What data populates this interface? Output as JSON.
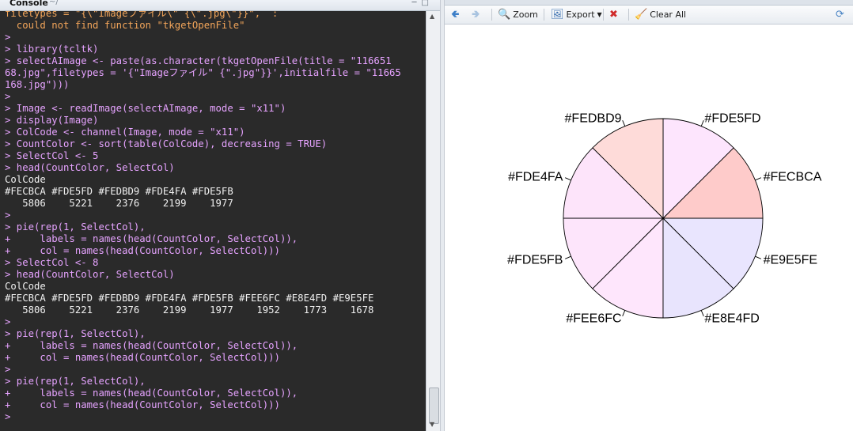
{
  "console": {
    "title": "Console",
    "path": "~/",
    "lines": [
      {
        "t": "filetypes = \"{\\\"Imageファイル\\\" {\\\".jpg\\\"}}\",  :",
        "k": "err"
      },
      {
        "t": "  could not find function \"tkgetOpenFile\"",
        "k": "err"
      },
      {
        "t": ">",
        "k": "cmd"
      },
      {
        "t": "> library(tcltk)",
        "k": "cmd"
      },
      {
        "t": "> selectAImage <- paste(as.character(tkgetOpenFile(title = \"116651",
        "k": "cmd"
      },
      {
        "t": "68.jpg\",filetypes = '{\"Imageファイル\" {\".jpg\"}}',initialfile = \"11665",
        "k": "cmd"
      },
      {
        "t": "168.jpg\")))",
        "k": "cmd"
      },
      {
        "t": ">",
        "k": "cmd"
      },
      {
        "t": "> Image <- readImage(selectAImage, mode = \"x11\")",
        "k": "cmd"
      },
      {
        "t": "> display(Image)",
        "k": "cmd"
      },
      {
        "t": "> ColCode <- channel(Image, mode = \"x11\")",
        "k": "cmd"
      },
      {
        "t": "> CountColor <- sort(table(ColCode), decreasing = TRUE)",
        "k": "cmd"
      },
      {
        "t": "> SelectCol <- 5",
        "k": "cmd"
      },
      {
        "t": "> head(CountColor, SelectCol)",
        "k": "cmd"
      },
      {
        "t": "ColCode",
        "k": "out"
      },
      {
        "t": "#FECBCA #FDE5FD #FEDBD9 #FDE4FA #FDE5FB",
        "k": "out"
      },
      {
        "t": "   5806    5221    2376    2199    1977",
        "k": "out"
      },
      {
        "t": ">",
        "k": "cmd"
      },
      {
        "t": "> pie(rep(1, SelectCol),",
        "k": "cmd"
      },
      {
        "t": "+     labels = names(head(CountColor, SelectCol)),",
        "k": "cmd"
      },
      {
        "t": "+     col = names(head(CountColor, SelectCol)))",
        "k": "cmd"
      },
      {
        "t": "> SelectCol <- 8",
        "k": "cmd"
      },
      {
        "t": "> head(CountColor, SelectCol)",
        "k": "cmd"
      },
      {
        "t": "ColCode",
        "k": "out"
      },
      {
        "t": "#FECBCA #FDE5FD #FEDBD9 #FDE4FA #FDE5FB #FEE6FC #E8E4FD #E9E5FE",
        "k": "out"
      },
      {
        "t": "   5806    5221    2376    2199    1977    1952    1773    1678",
        "k": "out"
      },
      {
        "t": ">",
        "k": "cmd"
      },
      {
        "t": "> pie(rep(1, SelectCol),",
        "k": "cmd"
      },
      {
        "t": "+     labels = names(head(CountColor, SelectCol)),",
        "k": "cmd"
      },
      {
        "t": "+     col = names(head(CountColor, SelectCol)))",
        "k": "cmd"
      },
      {
        "t": ">",
        "k": "cmd"
      },
      {
        "t": "> pie(rep(1, SelectCol),",
        "k": "cmd"
      },
      {
        "t": "+     labels = names(head(CountColor, SelectCol)),",
        "k": "cmd"
      },
      {
        "t": "+     col = names(head(CountColor, SelectCol)))",
        "k": "cmd"
      },
      {
        "t": ">",
        "k": "cmd"
      }
    ]
  },
  "toolbar": {
    "back_icon": "arrow-left-icon",
    "forward_icon": "arrow-right-icon",
    "zoom_label": "Zoom",
    "export_label": "Export",
    "remove_icon": "remove-plot-icon",
    "clear_label": "Clear All",
    "refresh_icon": "refresh-icon"
  },
  "colors": {
    "console_bg": "#2a2a2a",
    "command_text": "#e6a3ff",
    "error_text": "#f2a55a",
    "output_text": "#f0f0f0"
  },
  "chart_data": {
    "type": "pie",
    "values": [
      1,
      1,
      1,
      1,
      1,
      1,
      1,
      1
    ],
    "labels": [
      "#FECBCA",
      "#FDE5FD",
      "#FEDBD9",
      "#FDE4FA",
      "#FDE5FB",
      "#FEE6FC",
      "#E8E4FD",
      "#E9E5FE"
    ],
    "colors": [
      "#FECBCA",
      "#FDE5FD",
      "#FEDBD9",
      "#FDE4FA",
      "#FDE5FB",
      "#FEE6FC",
      "#E8E4FD",
      "#E9E5FE"
    ],
    "start_angle_deg": 0,
    "direction": "counterclockwise",
    "legend": "none",
    "title": ""
  }
}
